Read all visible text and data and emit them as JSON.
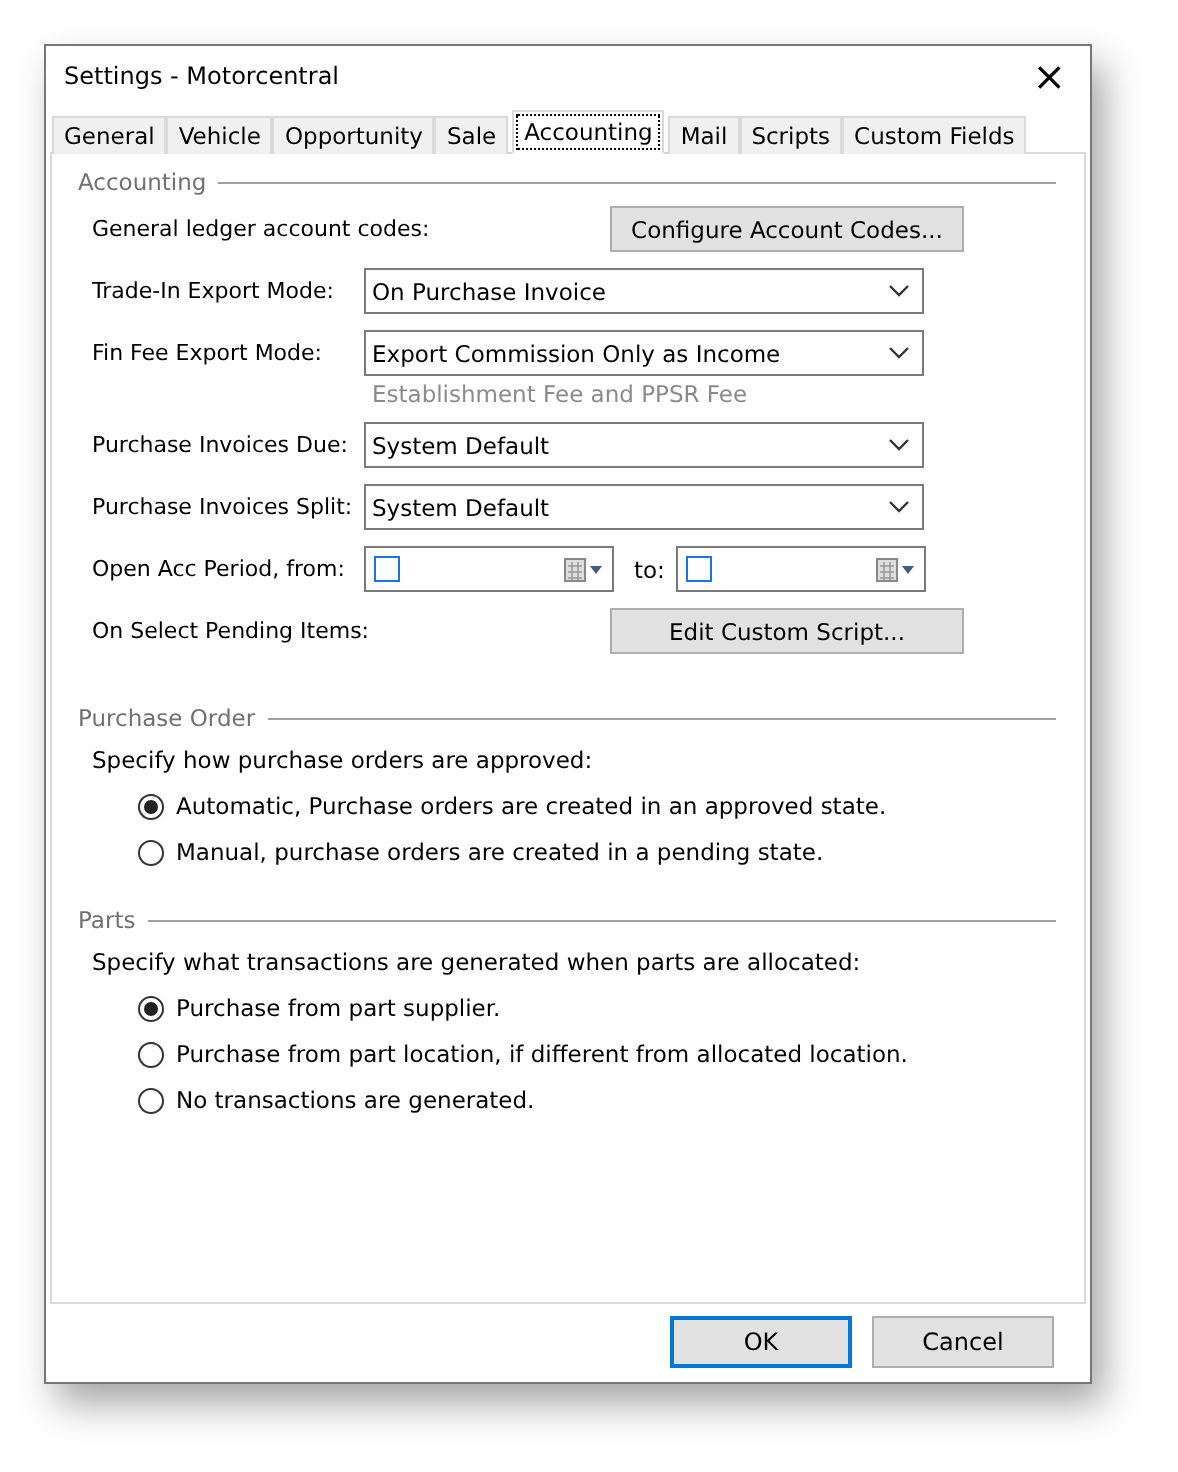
{
  "window": {
    "title": "Settings - Motorcentral",
    "close": "×"
  },
  "tabs": [
    {
      "label": "General",
      "selected": false
    },
    {
      "label": "Vehicle",
      "selected": false
    },
    {
      "label": "Opportunity",
      "selected": false
    },
    {
      "label": "Sale",
      "selected": false
    },
    {
      "label": "Accounting",
      "selected": true
    },
    {
      "label": "Mail",
      "selected": false
    },
    {
      "label": "Scripts",
      "selected": false
    },
    {
      "label": "Custom Fields",
      "selected": false
    }
  ],
  "accounting": {
    "title": "Accounting",
    "rows": [
      {
        "kind": "button",
        "label": "General ledger account codes:",
        "button": "Configure Account Codes..."
      },
      {
        "kind": "select",
        "label": "Trade-In Export Mode:",
        "value": "On Purchase Invoice"
      },
      {
        "kind": "select",
        "label": "Fin Fee Export Mode:",
        "value": "Export Commission Only as Income"
      },
      {
        "kind": "note",
        "text": "Establishment Fee and PPSR Fee"
      },
      {
        "kind": "select",
        "label": "Purchase Invoices Due:",
        "value": "System Default"
      },
      {
        "kind": "select",
        "label": "Purchase Invoices Split:",
        "value": "System Default"
      },
      {
        "kind": "dates",
        "label": "Open Acc Period, from:",
        "to": "to:",
        "from_checked": false,
        "to_checked": false
      },
      {
        "kind": "button",
        "label": "On Select Pending Items:",
        "button": "Edit Custom Script..."
      }
    ]
  },
  "purchase_order": {
    "title": "Purchase Order",
    "prompt": "Specify how purchase orders are approved:",
    "options": [
      {
        "label": "Automatic, Purchase orders are created in an approved state.",
        "selected": true
      },
      {
        "label": "Manual, purchase orders are created in a pending state.",
        "selected": false
      }
    ]
  },
  "parts": {
    "title": "Parts",
    "prompt": "Specify what transactions are generated when parts are allocated:",
    "options": [
      {
        "label": "Purchase from part supplier.",
        "selected": true
      },
      {
        "label": "Purchase from part location, if different from allocated location.",
        "selected": false
      },
      {
        "label": "No transactions are generated.",
        "selected": false
      }
    ]
  },
  "buttons": [
    {
      "label": "OK",
      "default": true
    },
    {
      "label": "Cancel",
      "default": false
    }
  ]
}
